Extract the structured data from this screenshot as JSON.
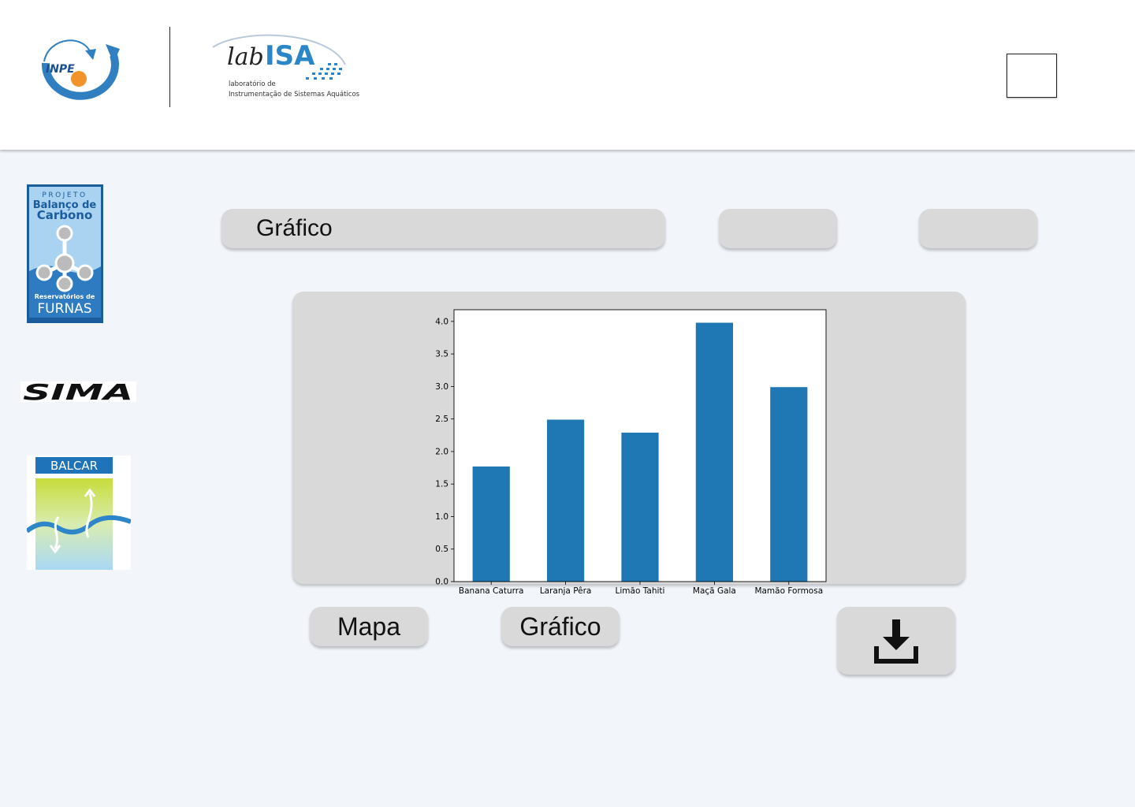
{
  "header": {
    "inpe_logo_text": "INPE",
    "labisa_logo_text": "labISA",
    "labisa_subtitle_line1": "laboratório de",
    "labisa_subtitle_line2": "Instrumentação de Sistemas Aquáticos"
  },
  "sidebar": {
    "furnas": {
      "line1": "PROJETO",
      "line2": "Balanço de",
      "line3": "Carbono",
      "line4": "Reservatórios de",
      "line5": "FURNAS"
    },
    "sima": "SIMA",
    "balcar": "BALCAR"
  },
  "controls": {
    "title_pill": "Gráfico",
    "button_a": "",
    "button_b": ""
  },
  "buttons": {
    "mapa": "Mapa",
    "grafico": "Gráfico",
    "download_icon": "download-icon"
  },
  "colors": {
    "bar": "#1f77b4",
    "panel": "#d9d9d9",
    "background": "#f2f6fb"
  },
  "chart_data": {
    "type": "bar",
    "categories": [
      "Banana Caturra",
      "Laranja Pêra",
      "Limão Tahiti",
      "Maçã Gala",
      "Mamão Formosa"
    ],
    "values": [
      1.77,
      2.49,
      2.29,
      3.98,
      2.99
    ],
    "ylim": [
      0,
      4.18
    ],
    "yticks": [
      "0.0",
      "0.5",
      "1.0",
      "1.5",
      "2.0",
      "2.5",
      "3.0",
      "3.5",
      "4.0"
    ],
    "title": "",
    "xlabel": "",
    "ylabel": ""
  }
}
